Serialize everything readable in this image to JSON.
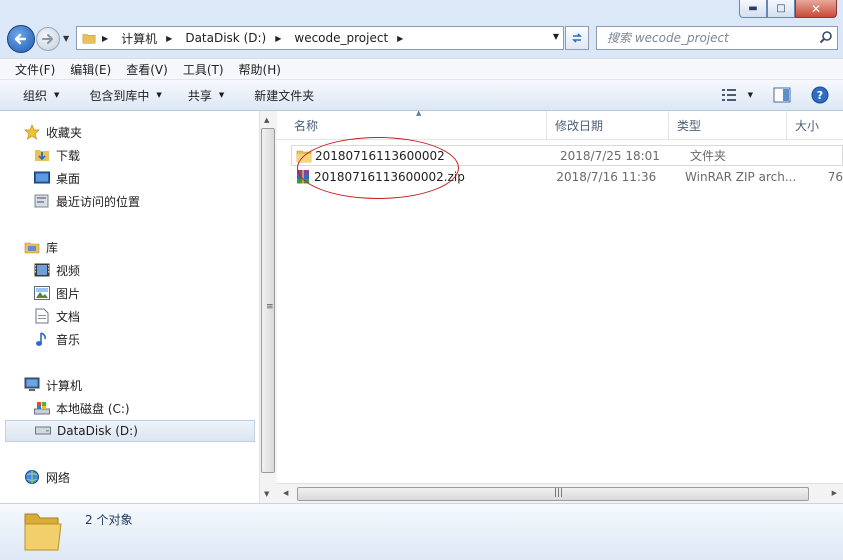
{
  "window": {
    "controls": {
      "minimize": "▬",
      "maximize": "□",
      "close": "✕"
    }
  },
  "address": {
    "crumbs": [
      "计算机",
      "DataDisk (D:)",
      "wecode_project"
    ]
  },
  "search": {
    "placeholder": "搜索 wecode_project"
  },
  "menu": [
    "文件(F)",
    "编辑(E)",
    "查看(V)",
    "工具(T)",
    "帮助(H)"
  ],
  "commands": [
    "组织",
    "包含到库中",
    "共享",
    "新建文件夹"
  ],
  "nav_pane": {
    "favorites": {
      "label": "收藏夹",
      "items": [
        "下载",
        "桌面",
        "最近访问的位置"
      ]
    },
    "libraries": {
      "label": "库",
      "items": [
        "视频",
        "图片",
        "文档",
        "音乐"
      ]
    },
    "computer": {
      "label": "计算机",
      "items": [
        "本地磁盘 (C:)",
        "DataDisk (D:)"
      ]
    },
    "network": {
      "label": "网络"
    }
  },
  "columns": [
    "名称",
    "修改日期",
    "类型",
    "大小"
  ],
  "files": [
    {
      "name": "20180716113600002",
      "modified": "2018/7/25 18:01",
      "type": "文件夹",
      "size": ""
    },
    {
      "name": "20180716113600002.zip",
      "modified": "2018/7/16 11:36",
      "type": "WinRAR ZIP arch...",
      "size": "76"
    }
  ],
  "status": {
    "count": "2 个对象"
  },
  "colors": {
    "annotation": "#c41e1e",
    "accent": "#1f5bb5"
  }
}
